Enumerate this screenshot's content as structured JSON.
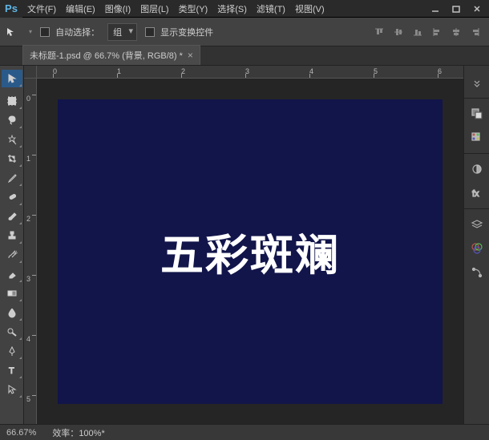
{
  "title": {
    "app": "Ps"
  },
  "menu": [
    "文件(F)",
    "编辑(E)",
    "图像(I)",
    "图层(L)",
    "类型(Y)",
    "选择(S)",
    "滤镜(T)",
    "视图(V)"
  ],
  "optbar": {
    "auto_select": "自动选择：",
    "select_value": "组",
    "show_transform": "显示变换控件"
  },
  "tab": {
    "label": "未标题-1.psd @ 66.7% (背景, RGB/8) *"
  },
  "ruler_top": [
    "0",
    "1",
    "2",
    "3",
    "4",
    "5",
    "6"
  ],
  "ruler_left": [
    "0",
    "1",
    "2",
    "3",
    "4",
    "5"
  ],
  "canvas": {
    "bg": "#12154a",
    "text": "五彩斑斓"
  },
  "status": {
    "zoom": "66.67%",
    "eff_label": "效率：",
    "eff_val": "100%*"
  },
  "tools": [
    "move",
    "marquee",
    "lasso",
    "wand",
    "crop",
    "eyedrop",
    "heal",
    "brush",
    "stamp",
    "history",
    "eraser",
    "gradient",
    "blur",
    "dodge",
    "pen",
    "type"
  ]
}
